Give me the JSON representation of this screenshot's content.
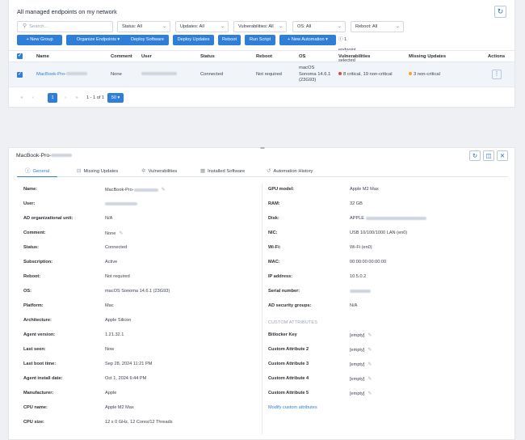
{
  "top": {
    "title": "All managed endpoints on my network",
    "search_placeholder": "Search...",
    "filters": [
      {
        "label": "Status: All"
      },
      {
        "label": "Updates: All"
      },
      {
        "label": "Vulnerabilities: All"
      },
      {
        "label": "OS: All"
      },
      {
        "label": "Reboot: All"
      }
    ],
    "actions": {
      "new_group": "+ New Group",
      "organize": "Organize Endpoints ▾",
      "deploy_software": "Deploy Software",
      "deploy_updates": "Deploy Updates",
      "reboot": "Reboot",
      "run_script": "Run Script",
      "new_automation": "+ New Automation ▾",
      "selected_count": "1 endpoint selected"
    },
    "table": {
      "headers": {
        "name": "Name",
        "comment": "Comment",
        "user": "User",
        "status": "Status",
        "reboot": "Reboot",
        "os": "OS",
        "vulnerabilities": "Vulnerabilities",
        "missing_updates": "Missing Updates",
        "actions": "Actions"
      },
      "row": {
        "name": "MacBook-Pro-",
        "comment": "None",
        "status": "Connected",
        "reboot": "Not required",
        "os_line1": "macOS",
        "os_line2": "Sonoma 14.6.1",
        "os_line3": "(23G93)",
        "vulnerabilities": "8 critical, 19 non-critical",
        "missing_updates": "3 non-critical"
      }
    },
    "pager": {
      "current_page": "1",
      "range": "1 - 1 of 1",
      "page_size": "50 ▾"
    }
  },
  "detail": {
    "title": "MacBook-Pro-",
    "tabs": {
      "general": "General",
      "missing_updates": "Missing Updates",
      "vulnerabilities": "Vulnerabilities",
      "installed_software": "Installed Software",
      "automation_history": "Automation History"
    },
    "left": [
      {
        "label": "Name:",
        "value": "MacBook-Pro-"
      },
      {
        "label": "User:",
        "value": ""
      },
      {
        "label": "AD organizational unit:",
        "value": "N/A"
      },
      {
        "label": "Comment:",
        "value": "None"
      },
      {
        "label": "Status:",
        "value": "Connected"
      },
      {
        "label": "Subscription:",
        "value": "Active"
      },
      {
        "label": "Reboot:",
        "value": "Not required"
      },
      {
        "label": "OS:",
        "value": "macOS Sonoma 14.6.1 (23G93)"
      },
      {
        "label": "Platform:",
        "value": "Mac"
      },
      {
        "label": "Architecture:",
        "value": "Apple Silicon"
      },
      {
        "label": "Agent version:",
        "value": "1.21.32.1"
      },
      {
        "label": "Last seen:",
        "value": "Now"
      },
      {
        "label": "Last boot time:",
        "value": "Sep 28, 2024 11:21 PM"
      },
      {
        "label": "Agent install date:",
        "value": "Oct 1, 2024 6:44 PM"
      },
      {
        "label": "Manufacturer:",
        "value": "Apple"
      },
      {
        "label": "CPU name:",
        "value": "Apple M2 Max"
      },
      {
        "label": "CPU size:",
        "value": "12 x 0 GHz, 12 Cores/12 Threads"
      }
    ],
    "right": [
      {
        "label": "GPU model:",
        "value": "Apple M2 Max"
      },
      {
        "label": "RAM:",
        "value": "32 GB"
      },
      {
        "label": "Disk:",
        "value": "APPLE"
      },
      {
        "label": "NIC:",
        "value": "USB 10/100/1000 LAN (en0)"
      },
      {
        "label": "Wi-Fi:",
        "value": "Wi-Fi (en0)"
      },
      {
        "label": "MAC:",
        "value": "00:00:00:00:00:00"
      },
      {
        "label": "IP address:",
        "value": "10.5.0.2"
      },
      {
        "label": "Serial number:",
        "value": ""
      },
      {
        "label": "AD security groups:",
        "value": "N/A"
      }
    ],
    "custom_heading": "CUSTOM ATTRIBUTES",
    "custom": [
      {
        "label": "Bitlocker Key",
        "value": "[empty]"
      },
      {
        "label": "Custom Attribute 2",
        "value": "[empty]"
      },
      {
        "label": "Custom Attribute 3",
        "value": "[empty]"
      },
      {
        "label": "Custom Attribute 4",
        "value": "[empty]"
      },
      {
        "label": "Custom Attribute 5",
        "value": "[empty]"
      }
    ],
    "modify_link": "Modify custom attributes"
  },
  "colors": {
    "accent": "#2f7fd9",
    "critical": "#e0473e",
    "warning": "#f5a623"
  }
}
